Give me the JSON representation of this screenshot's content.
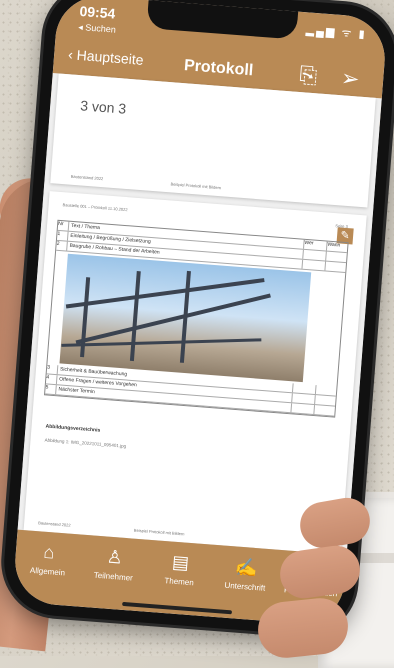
{
  "status": {
    "time": "09:54",
    "back_link": "◂ Suchen",
    "icons": "▂▄▆ ᯤ ▮"
  },
  "nav": {
    "back_label": "Hauptseite",
    "title": "Protokoll",
    "icons": [
      "save-pdf-icon",
      "send-icon"
    ]
  },
  "viewer": {
    "page_counter": "3 von 3"
  },
  "document": {
    "header_left": "Baustelle 001 – Protokoll 11.10.2022",
    "header_right": "Seite 3",
    "footer_left": "Bautenstand 2022",
    "footer_mid": "Beispiel Protokoll mit Bildern",
    "rows": [
      {
        "nr": "Nr",
        "text": "Text / Thema",
        "col3": "Wer",
        "col4": "Wann"
      },
      {
        "nr": "1",
        "text": "Einleitung / Begrüßung / Zielsetzung",
        "col3": "",
        "col4": ""
      },
      {
        "nr": "2",
        "text": "Baugrube / Rohbau – Stand der Arbeiten",
        "col3": "",
        "col4": ""
      },
      {
        "nr": "3",
        "text": "Sicherheit & Bauüberwachung",
        "col3": "",
        "col4": ""
      },
      {
        "nr": "4",
        "text": "Offene Fragen / weiteres Vorgehen",
        "col3": "",
        "col4": ""
      },
      {
        "nr": "5",
        "text": "Nächster Termin",
        "col3": "",
        "col4": ""
      }
    ],
    "appendix": "Abbildungsverzeichnis",
    "caption": "Abbildung 1: IMG_20221011_095401.jpg"
  },
  "tabs": [
    {
      "label": "Allgemein",
      "icon": "house-icon"
    },
    {
      "label": "Teilnehmer",
      "icon": "person-icon"
    },
    {
      "label": "Themen",
      "icon": "document-icon"
    },
    {
      "label": "Unterschrift",
      "icon": "signature-icon"
    },
    {
      "label": "PDF & Senden",
      "icon": "pdf-send-icon"
    }
  ],
  "colors": {
    "accent": "#b98a55",
    "background": "#dcd7cc"
  }
}
